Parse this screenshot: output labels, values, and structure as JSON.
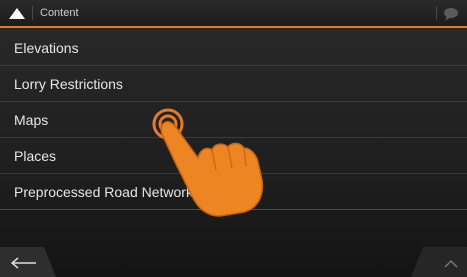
{
  "header": {
    "title": "Content",
    "menu_icon": "triangle-up-icon",
    "chat_icon": "speech-bubble-icon"
  },
  "list": {
    "items": [
      {
        "label": "Elevations"
      },
      {
        "label": "Lorry Restrictions"
      },
      {
        "label": "Maps"
      },
      {
        "label": "Places"
      },
      {
        "label": "Preprocessed Road Network"
      }
    ]
  },
  "footer": {
    "back_icon": "arrow-left-icon",
    "up_icon": "chevron-up-icon"
  },
  "overlay": {
    "hand_icon": "tap-hand-icon"
  },
  "colors": {
    "accent": "#e8782a",
    "background": "#1f1f1f",
    "text": "#e6e6e6"
  }
}
